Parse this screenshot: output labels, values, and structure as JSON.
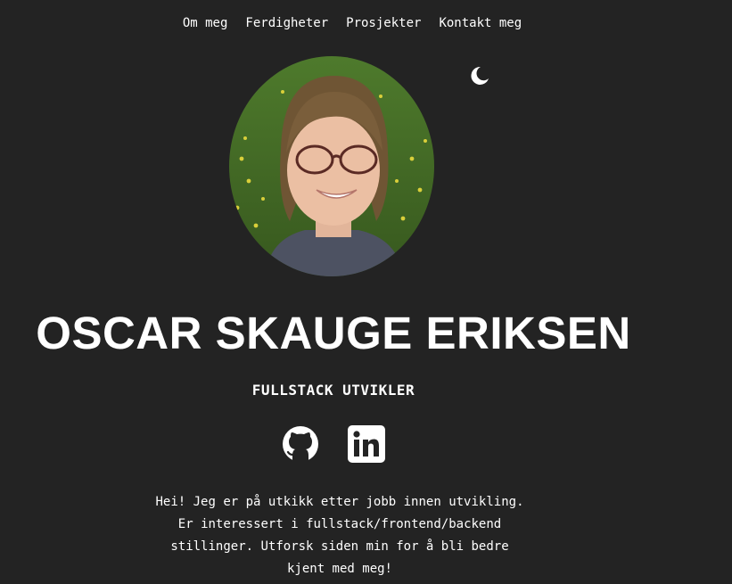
{
  "nav": {
    "items": [
      {
        "label": "Om meg"
      },
      {
        "label": "Ferdigheter"
      },
      {
        "label": "Prosjekter"
      },
      {
        "label": "Kontakt meg"
      }
    ]
  },
  "theme_toggle": {
    "icon": "moon-icon"
  },
  "profile": {
    "name": "OSCAR SKAUGE ERIKSEN",
    "role": "FULLSTACK UTVIKLER"
  },
  "socials": [
    {
      "icon": "github-icon"
    },
    {
      "icon": "linkedin-icon"
    }
  ],
  "bio": {
    "lines": [
      "Hei! Jeg er på utkikk etter jobb innen utvikling.",
      "Er interessert i fullstack/frontend/backend",
      "stillinger. Utforsk siden min for å bli bedre",
      "kjent med meg!"
    ]
  },
  "colors": {
    "background": "#232323",
    "text": "#ffffff"
  }
}
